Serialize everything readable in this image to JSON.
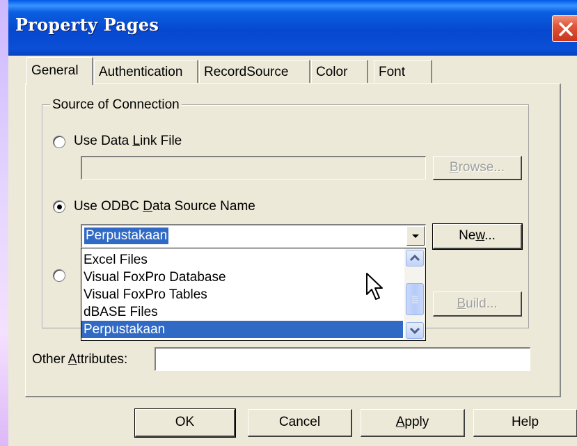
{
  "window": {
    "title": "Property Pages"
  },
  "tabs": [
    {
      "label": "General",
      "active": true
    },
    {
      "label": "Authentication",
      "active": false
    },
    {
      "label": "RecordSource",
      "active": false
    },
    {
      "label": "Color",
      "active": false
    },
    {
      "label": "Font",
      "active": false
    }
  ],
  "connection": {
    "group_label": "Source of Connection",
    "data_link": {
      "label": "Use Data Link File",
      "selected": false,
      "value": "",
      "browse_label": "Browse..."
    },
    "odbc": {
      "label": "Use ODBC Data Source Name",
      "selected": true,
      "value": "Perpustakaan",
      "new_label": "New..."
    },
    "third_option": {
      "selected": false,
      "build_label": "Build..."
    },
    "dropdown_options": [
      "Excel Files",
      "Visual FoxPro Database",
      "Visual FoxPro Tables",
      "dBASE Files",
      "Perpustakaan"
    ],
    "dropdown_selected": "Perpustakaan"
  },
  "other_attributes": {
    "label": "Other Attributes:",
    "value": ""
  },
  "buttons": {
    "ok": "OK",
    "cancel": "Cancel",
    "apply": "Apply",
    "help": "Help"
  },
  "colors": {
    "titlebar": "#0a4fd6",
    "selection": "#316ac5",
    "face": "#ece9d8"
  },
  "icons": [
    "close-icon",
    "dropdown-arrow-icon",
    "scroll-up-icon",
    "scroll-down-icon",
    "mouse-cursor-icon"
  ]
}
